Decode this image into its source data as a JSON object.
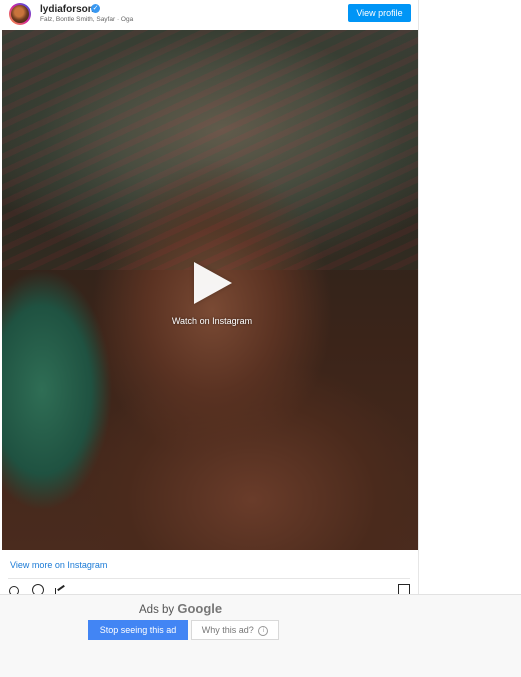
{
  "post": {
    "username": "lydiaforson",
    "subtitle": "Falz, Bontle Smith, Sayfar · Oga",
    "view_profile_label": "View profile",
    "watch_label": "Watch on Instagram",
    "view_more_label": "View more on Instagram",
    "verified_glyph": "✓"
  },
  "ads": {
    "ads_by_label": "Ads by",
    "google_label": "Google",
    "stop_label": "Stop seeing this ad",
    "why_label": "Why this ad?",
    "info_glyph": "i"
  },
  "colors": {
    "view_profile_bg": "#0095f6",
    "link_blue": "#1a7ad6",
    "stop_button_bg": "#4285f4"
  }
}
